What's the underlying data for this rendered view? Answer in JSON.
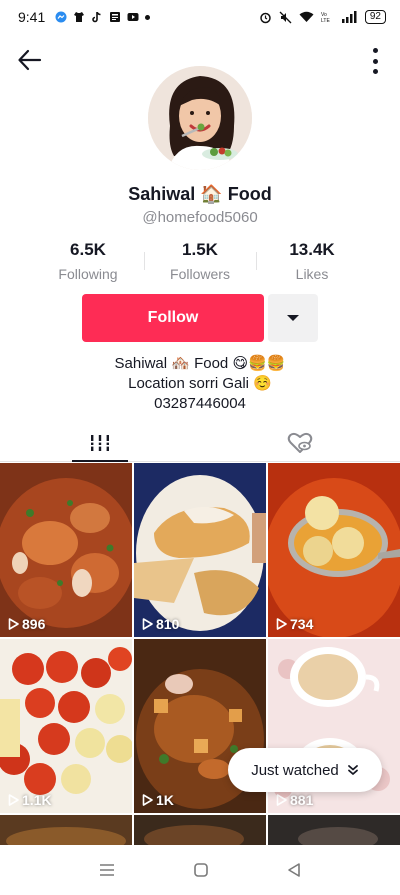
{
  "status_bar": {
    "time": "9:41",
    "icons_left": [
      "messenger-icon",
      "shirt-icon",
      "tiktok-icon",
      "news-icon",
      "youtube-icon"
    ],
    "icons_right": [
      "alarm-icon",
      "mute-icon",
      "wifi-icon",
      "volte-icon",
      "signal-icon"
    ],
    "battery": "92"
  },
  "profile": {
    "display_name": "Sahiwal 🏠 Food",
    "username": "@homefood5060",
    "stats": [
      {
        "value": "6.5K",
        "label": "Following"
      },
      {
        "value": "1.5K",
        "label": "Followers"
      },
      {
        "value": "13.4K",
        "label": "Likes"
      }
    ],
    "follow_label": "Follow",
    "bio_lines": [
      "Sahiwal 🏘️ Food 😋🍔🍔",
      "Location sorri Gali ☺️",
      "03287446004"
    ]
  },
  "tabs": [
    {
      "name": "videos-tab",
      "icon": "grid-lines-icon",
      "selected": true
    },
    {
      "name": "liked-tab",
      "icon": "heart-hidden-icon",
      "selected": false
    }
  ],
  "videos": [
    {
      "views": "896",
      "colors": [
        "#9a3c1f",
        "#d86a3a",
        "#6a2a12"
      ]
    },
    {
      "views": "810",
      "colors": [
        "#e9d7b6",
        "#c9913f",
        "#1f2f6a"
      ]
    },
    {
      "views": "734",
      "colors": [
        "#c23a16",
        "#e8692c",
        "#f5d78a"
      ]
    },
    {
      "views": "1.1K",
      "colors": [
        "#d63a1e",
        "#f3e7a4",
        "#f6f2ea"
      ]
    },
    {
      "views": "1K",
      "colors": [
        "#6a3a1a",
        "#b8622a",
        "#e6a25a"
      ]
    },
    {
      "views": "881",
      "colors": [
        "#efd9d9",
        "#e8cfa2",
        "#ffffff"
      ]
    }
  ],
  "just_watched_label": "Just watched",
  "accent": "#fe2c55"
}
